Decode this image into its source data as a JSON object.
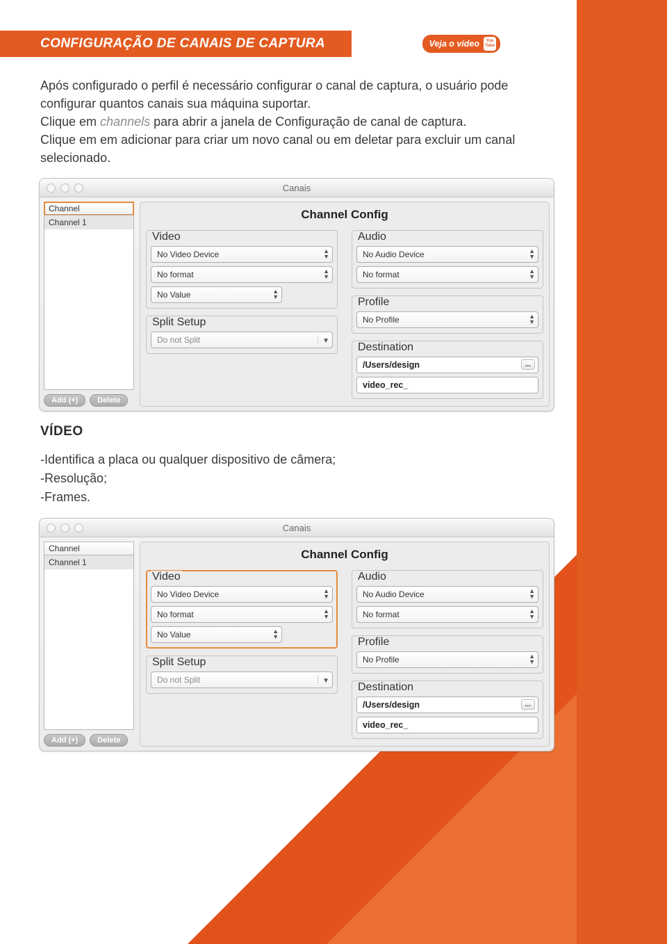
{
  "header": {
    "title": "CONFIGURAÇÃO DE CANAIS DE CAPTURA",
    "video_link": "Veja o vídeo",
    "yt_top": "You",
    "yt_bot": "Tube"
  },
  "intro": {
    "p1": "Após configurado o perfil é necessário configurar o canal de captura, o usuário pode configurar quantos canais sua máquina suportar.",
    "p2a": "Clique em ",
    "p2em": "channels",
    "p2b": " para abrir a janela de Configuração de canal de captura.",
    "p3": "Clique em em adicionar para criar um novo canal ou em deletar para excluir um canal selecionado."
  },
  "win1": {
    "title": "Canais",
    "sidebar_header": "Channel",
    "sidebar_item": "Channel 1",
    "add_label": "Add (+)",
    "delete_label": "Delete",
    "config_title": "Channel Config",
    "video_label": "Video",
    "video_device": "No Video Device",
    "video_format": "No format",
    "video_value": "No Value",
    "split_label": "Split Setup",
    "split_value": "Do not Split",
    "audio_label": "Audio",
    "audio_device": "No Audio Device",
    "audio_format": "No format",
    "profile_label": "Profile",
    "profile_value": "No Profile",
    "dest_label": "Destination",
    "dest_path": "/Users/design",
    "dest_browse": "...",
    "dest_prefix": "video_rec_"
  },
  "video_section": {
    "heading": "VÍDEO",
    "l1": "-Identifica a placa ou qualquer dispositivo de câmera;",
    "l2": "-Resolução;",
    "l3": "-Frames."
  },
  "win2": {
    "title": "Canais",
    "sidebar_header": "Channel",
    "sidebar_item": "Channel 1",
    "add_label": "Add (+)",
    "delete_label": "Delete",
    "config_title": "Channel Config",
    "video_label": "Video",
    "video_device": "No Video Device",
    "video_format": "No format",
    "video_value": "No Value",
    "split_label": "Split Setup",
    "split_value": "Do not Split",
    "audio_label": "Audio",
    "audio_device": "No Audio Device",
    "audio_format": "No format",
    "profile_label": "Profile",
    "profile_value": "No Profile",
    "dest_label": "Destination",
    "dest_path": "/Users/design",
    "dest_browse": "...",
    "dest_prefix": "video_rec_"
  }
}
